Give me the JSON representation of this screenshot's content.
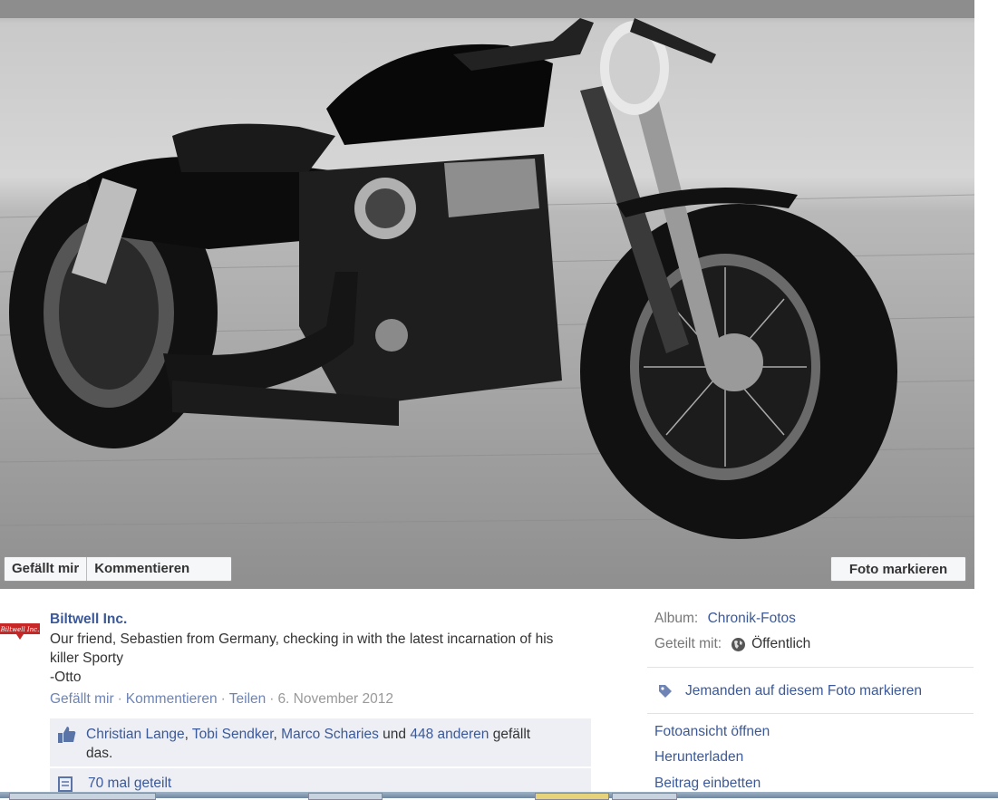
{
  "photo_buttons": {
    "like": "Gefällt mir",
    "comment": "Kommentieren",
    "tag_photo": "Foto markieren"
  },
  "post": {
    "author": "Biltwell Inc.",
    "logo_text": "Biltwell Inc.",
    "caption_lines": [
      "Our friend, Sebastien from Germany, checking in with the latest incarnation of his",
      "killer Sporty",
      "-Otto"
    ],
    "actions": {
      "like": "Gefällt mir",
      "comment": "Kommentieren",
      "share": "Teilen",
      "date": "6. November 2012"
    },
    "likes": {
      "name1": "Christian Lange",
      "name2": "Tobi Sendker",
      "name3": "Marco Scharies",
      "und": " und ",
      "others": "448 anderen",
      "tail": " gefällt",
      "tail2": "das."
    },
    "shares": "70 mal geteilt"
  },
  "sidebar": {
    "album_label": "Album:",
    "album_value": "Chronik-Fotos",
    "shared_label": "Geteilt mit:",
    "shared_value": "Öffentlich",
    "tag_someone": "Jemanden auf diesem Foto markieren",
    "links": [
      "Fotoansicht öffnen",
      "Herunterladen",
      "Beitrag einbetten"
    ]
  },
  "icons": {
    "globe": "globe-icon",
    "tag": "tag-icon",
    "thumbs_up": "thumbs-up-icon",
    "share": "share-icon"
  },
  "colors": {
    "link": "#3b5998",
    "muted": "#999999",
    "box": "#edeff4"
  }
}
